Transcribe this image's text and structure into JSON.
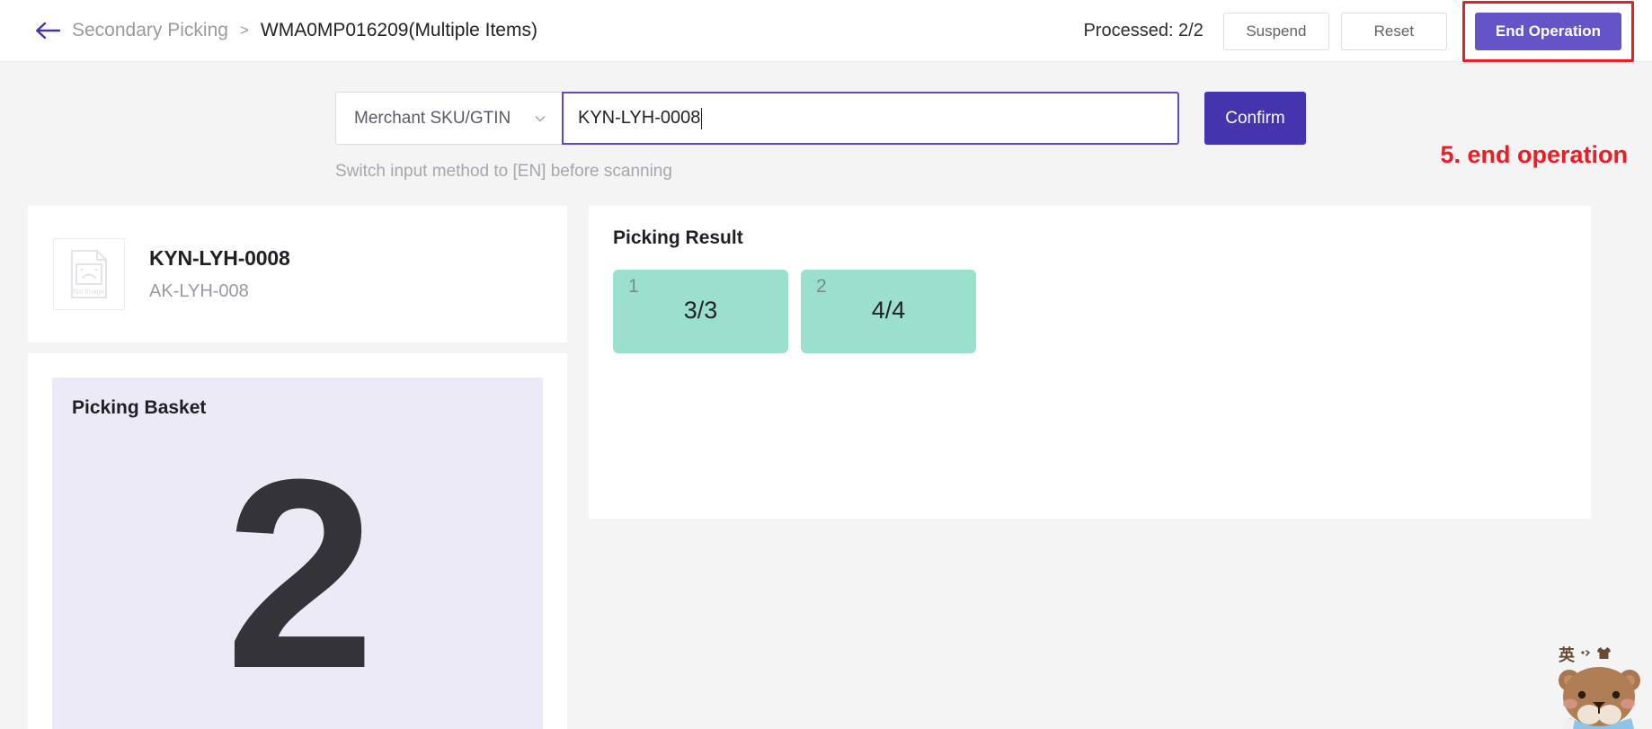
{
  "header": {
    "back_icon": "arrow-left-icon",
    "breadcrumb_parent": "Secondary Picking",
    "breadcrumb_separator": ">",
    "breadcrumb_current": "WMA0MP016209(Multiple Items)",
    "processed_label": "Processed: 2/2",
    "suspend_label": "Suspend",
    "reset_label": "Reset",
    "end_operation_label": "End Operation",
    "primary_color": "#6454c8",
    "highlight_box_color": "#ee1c25"
  },
  "annotation": {
    "text": "5. end operation",
    "color": "#ee1c25"
  },
  "scan": {
    "select_value": "Merchant SKU/GTIN",
    "select_icon": "chevron-down-icon",
    "input_value": "KYN-LYH-0008",
    "input_placeholder": "",
    "confirm_label": "Confirm",
    "confirm_color": "#4434ad",
    "hint": "Switch input method to [EN] before scanning"
  },
  "product": {
    "image_placeholder_text": "No Image",
    "image_icon": "no-image-icon",
    "title": "KYN-LYH-0008",
    "subtitle": "AK-LYH-008"
  },
  "basket": {
    "title": "Picking Basket",
    "number": "2",
    "bg_color": "#eceaf7"
  },
  "picking_result": {
    "title": "Picking Result",
    "tile_color": "#9ae0cd",
    "tiles": [
      {
        "index": "1",
        "value": "3/3"
      },
      {
        "index": "2",
        "value": "4/4"
      }
    ]
  },
  "mascot": {
    "ime_label": "英",
    "dot_icon": "dot-icon",
    "shirt_icon": "shirt-icon",
    "character_icon": "bear-mascot-icon"
  }
}
